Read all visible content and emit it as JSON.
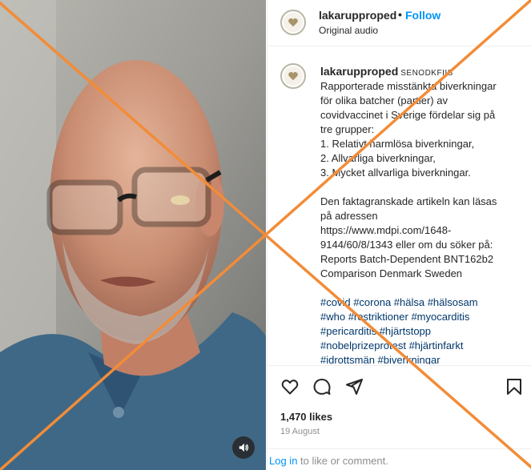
{
  "header": {
    "username": "lakarupproped",
    "separator": "•",
    "follow_label": "Follow",
    "audio_label": "Original audio"
  },
  "post": {
    "username": "lakarupproped",
    "username_tag": "SENODKFIIS",
    "caption_lines": [
      "Rapporterade misstänkta biverkningar",
      "för olika batcher (partier) av",
      "covidvaccinet i Sverige fördelar sig på",
      "tre grupper:",
      "1. Relativt harmlösa biverkningar,",
      "2. Allvarliga biverkningar,",
      "3. Mycket allvarliga biverkningar."
    ],
    "caption_lines_2": [
      "Den faktagranskade artikeln kan läsas",
      "på adressen",
      "https://www.mdpi.com/1648-",
      "9144/60/8/1343 eller om du söker på:",
      "Reports Batch-Dependent BNT162b2",
      "Comparison Denmark Sweden"
    ],
    "hashtag_lines": [
      "#covid #corona #hälsa #hälsosam",
      "#who #restriktioner #myocarditis",
      "#pericarditis #hjärtstopp",
      "#nobelprizeprotest #hjärtinfarkt",
      "#idrottsmän #biverkningar"
    ]
  },
  "actions": {
    "like_icon": "heart-icon",
    "comment_icon": "comment-icon",
    "share_icon": "paper-plane-icon",
    "save_icon": "bookmark-icon",
    "likes": "1,470 likes",
    "date": "19 August"
  },
  "footer": {
    "login_label": "Log in",
    "login_suffix": " to like or comment."
  },
  "video": {
    "mute_icon": "speaker-icon"
  },
  "colors": {
    "cross": "#f28c38",
    "follow": "#0095f6",
    "hashtag": "#00376b"
  }
}
